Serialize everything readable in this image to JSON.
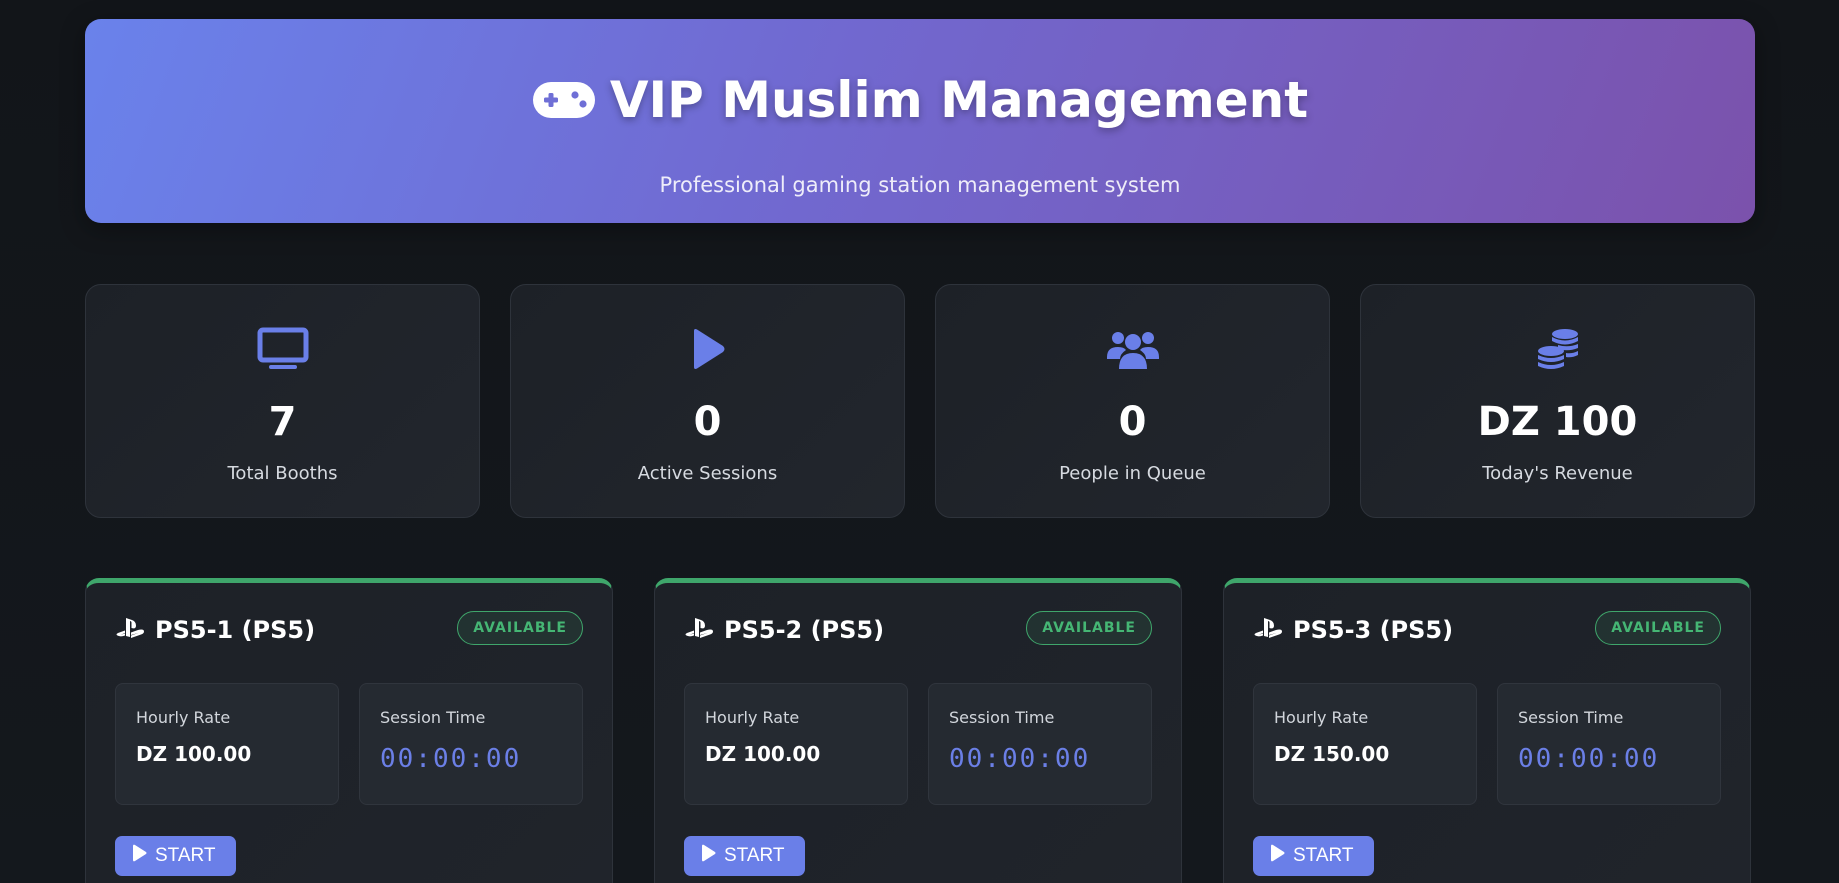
{
  "header": {
    "title": "VIP Muslim Management",
    "subtitle": "Professional gaming station management system",
    "icon": "gamepad-icon"
  },
  "colors": {
    "accent": "#6a7fe8",
    "available": "#3fa66b",
    "background": "#121519"
  },
  "stats": [
    {
      "icon": "monitor-icon",
      "value": "7",
      "label": "Total Booths"
    },
    {
      "icon": "play-icon",
      "value": "0",
      "label": "Active Sessions"
    },
    {
      "icon": "users-icon",
      "value": "0",
      "label": "People in Queue"
    },
    {
      "icon": "coins-icon",
      "value": "DZ 100",
      "label": "Today's Revenue"
    }
  ],
  "booths": [
    {
      "icon": "playstation-icon",
      "name": "PS5-1 (PS5)",
      "status": "AVAILABLE",
      "rate_label": "Hourly Rate",
      "rate": "DZ 100.00",
      "time_label": "Session Time",
      "time": "00:00:00",
      "start_label": "START"
    },
    {
      "icon": "playstation-icon",
      "name": "PS5-2 (PS5)",
      "status": "AVAILABLE",
      "rate_label": "Hourly Rate",
      "rate": "DZ 100.00",
      "time_label": "Session Time",
      "time": "00:00:00",
      "start_label": "START"
    },
    {
      "icon": "playstation-icon",
      "name": "PS5-3 (PS5)",
      "status": "AVAILABLE",
      "rate_label": "Hourly Rate",
      "rate": "DZ 150.00",
      "time_label": "Session Time",
      "time": "00:00:00",
      "start_label": "START"
    }
  ]
}
